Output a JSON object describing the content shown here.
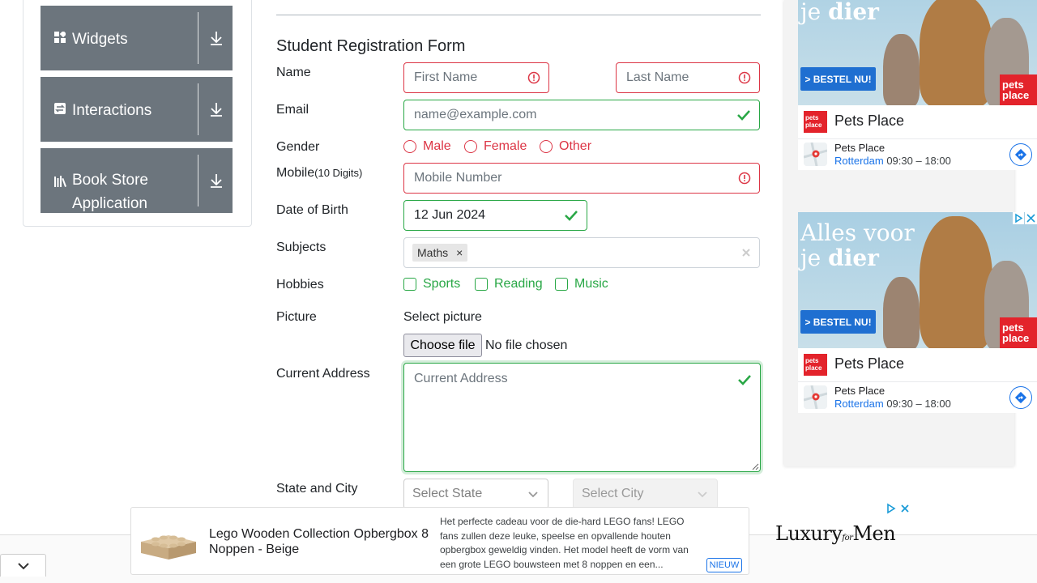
{
  "sidebar": {
    "groups": [
      {
        "label": "Widgets"
      },
      {
        "label": "Interactions"
      },
      {
        "label": "Book Store Application"
      }
    ]
  },
  "form": {
    "title": "Student Registration Form",
    "name_label": "Name",
    "first_name_placeholder": "First Name",
    "last_name_placeholder": "Last Name",
    "email_label": "Email",
    "email_placeholder": "name@example.com",
    "gender_label": "Gender",
    "gender_options": [
      "Male",
      "Female",
      "Other"
    ],
    "mobile_label": "Mobile",
    "mobile_hint": "(10 Digits)",
    "mobile_placeholder": "Mobile Number",
    "dob_label": "Date of Birth",
    "dob_value": "12 Jun 2024",
    "subjects_label": "Subjects",
    "subjects_selected": [
      "Maths"
    ],
    "hobbies_label": "Hobbies",
    "hobbies_options": [
      "Sports",
      "Reading",
      "Music"
    ],
    "picture_label": "Picture",
    "picture_select_text": "Select picture",
    "choose_file_label": "Choose file",
    "no_file_text": "No file chosen",
    "address_label": "Current Address",
    "address_placeholder": "Current Address",
    "state_city_label": "State and City",
    "state_placeholder": "Select State",
    "city_placeholder": "Select City"
  },
  "colors": {
    "invalid": "#dc3545",
    "valid": "#28a745",
    "sidebar_bg": "#6c757d",
    "ad_link": "#1a73e8",
    "ad_red": "#e3232b"
  },
  "right_ads": [
    {
      "headline_line1": "",
      "headline_line2_plain": "je ",
      "headline_line2_bold": "dier",
      "cta": "> BESTEL NU!",
      "logo_text_1": "pets",
      "logo_text_2": "place",
      "brand": "Pets Place",
      "location_name": "Pets Place",
      "location_city": "Rotterdam",
      "location_hours": "09:30 – 18:00"
    },
    {
      "headline_line1": "Alles voor",
      "headline_line2_plain": "je ",
      "headline_line2_bold": "dier",
      "cta": "> BESTEL NU!",
      "logo_text_1": "pets",
      "logo_text_2": "place",
      "brand": "Pets Place",
      "location_name": "Pets Place",
      "location_city": "Rotterdam",
      "location_hours": "09:30 – 18:00"
    }
  ],
  "bottom_ad": {
    "title": "Lego Wooden Collection Opbergbox 8 Noppen - Beige",
    "description": "Het perfecte cadeau voor de die-hard LEGO fans! LEGO fans zullen deze leuke, speelse en opvallende houten opbergbox geweldig vinden. Het model heeft de vorm van een grote LEGO bouwsteen met 8 noppen en een...",
    "badge": "NIEUW",
    "brand_logo_1": "Luxury",
    "brand_logo_2": "for",
    "brand_logo_3": "Men"
  },
  "icons": {
    "widgets": "grid-icon",
    "interactions": "swap-icon",
    "book_store": "books-icon",
    "expand": "download-arrow-icon",
    "error": "exclamation-circle-icon",
    "valid": "checkmark-icon",
    "clear": "close-icon",
    "collapse": "chevron-down-icon"
  }
}
